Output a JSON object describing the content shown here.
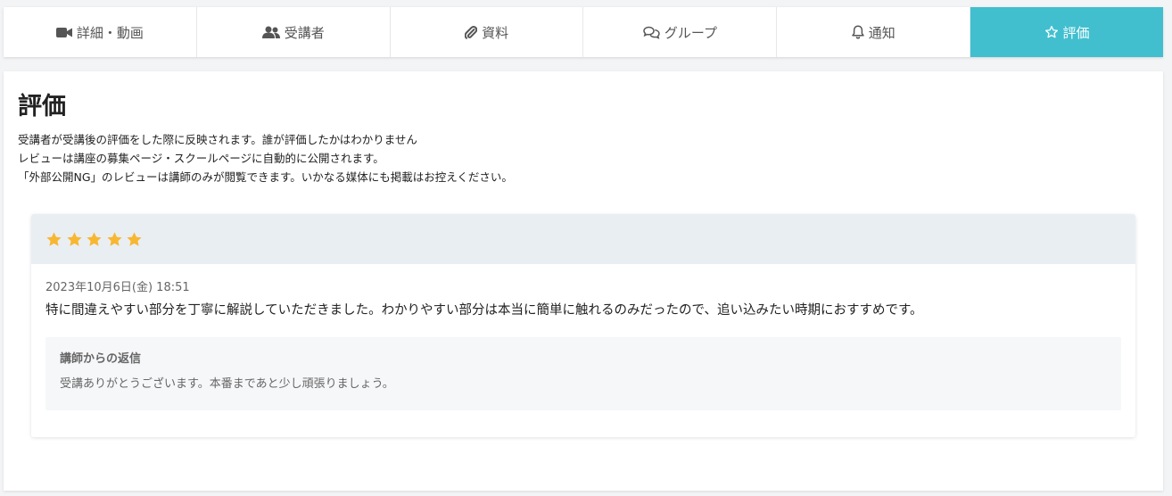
{
  "tabs": [
    {
      "label": "詳細・動画",
      "icon": "video-camera-icon"
    },
    {
      "label": "受講者",
      "icon": "users-icon"
    },
    {
      "label": "資料",
      "icon": "paperclip-icon"
    },
    {
      "label": "グループ",
      "icon": "comments-icon"
    },
    {
      "label": "通知",
      "icon": "bell-icon"
    },
    {
      "label": "評価",
      "icon": "star-outline-icon",
      "active": true
    }
  ],
  "page": {
    "title": "評価",
    "description": [
      "受講者が受講後の評価をした際に反映されます。誰が評価したかはわかりません",
      "レビューは講座の募集ページ・スクールページに自動的に公開されます。",
      "「外部公開NG」のレビューは講師のみが閲覧できます。いかなる媒体にも掲載はお控えください。"
    ]
  },
  "review": {
    "rating": 5,
    "max_rating": 5,
    "date": "2023年10月6日(金) 18:51",
    "text": "特に間違えやすい部分を丁寧に解説していただきました。わかりやすい部分は本当に簡単に触れるのみだったので、追い込みたい時期におすすめです。",
    "reply": {
      "title": "講師からの返信",
      "text": "受講ありがとうございます。本番まであと少し頑張りましょう。"
    }
  },
  "colors": {
    "accent": "#41bfcf",
    "star": "#f7b731",
    "card_header_bg": "#e9eef3",
    "reply_bg": "#f6f7f9"
  }
}
